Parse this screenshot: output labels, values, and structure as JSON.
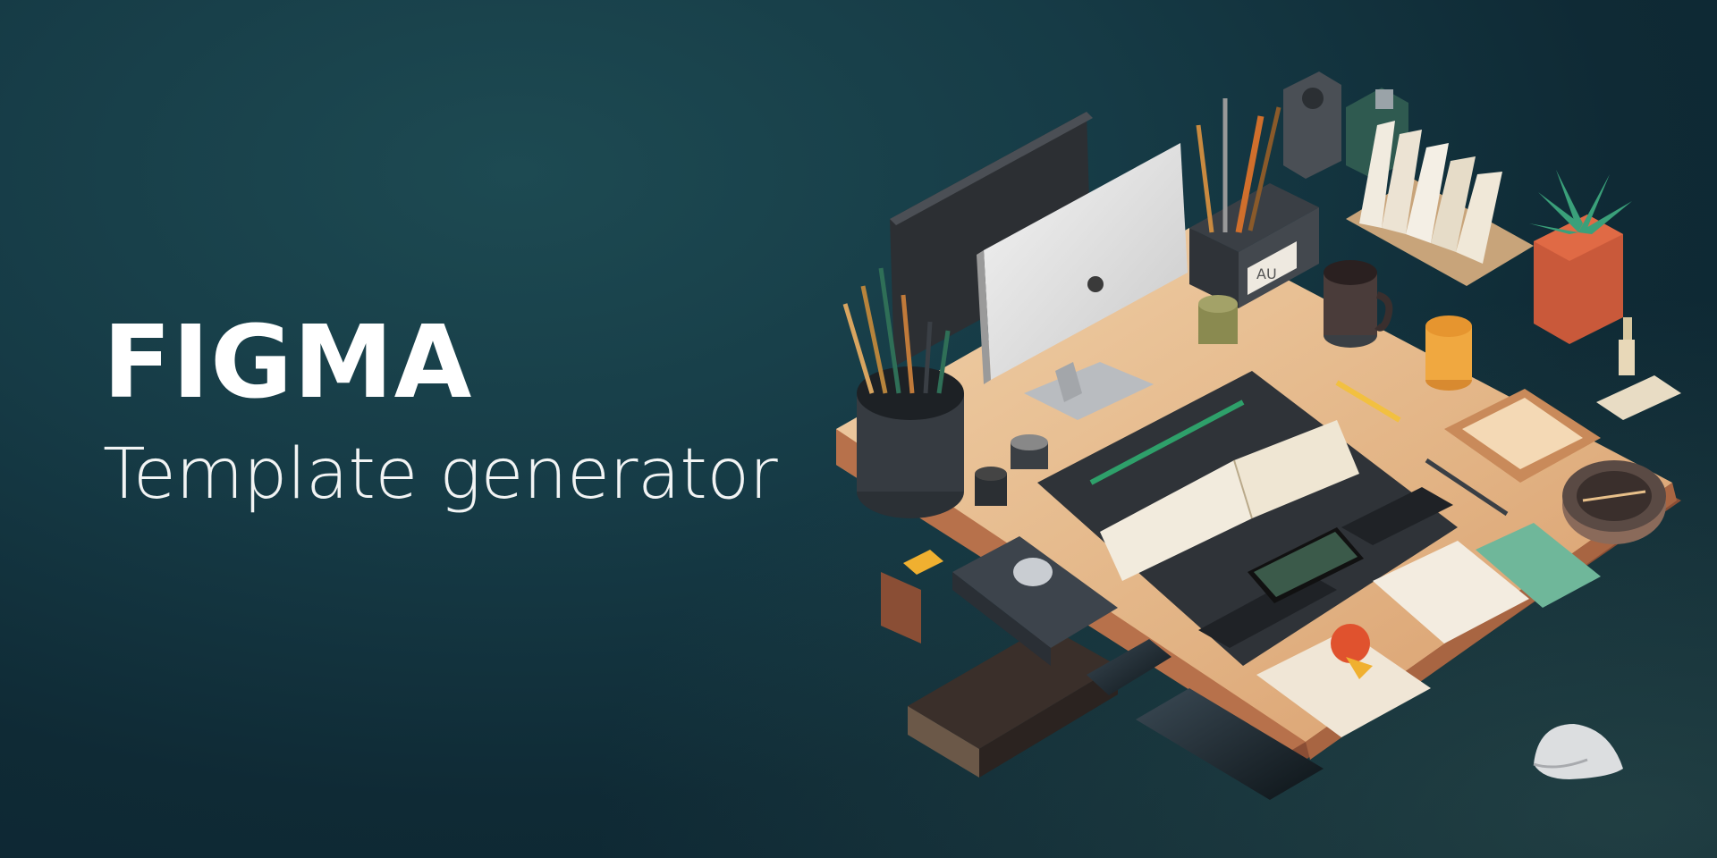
{
  "hero": {
    "title": "FIGMA",
    "subtitle": "Template generator"
  },
  "illustration": {
    "monitor_label": "AU"
  },
  "colors": {
    "background": "#163b46",
    "desk": "#e2b384",
    "text": "#ffffff"
  }
}
